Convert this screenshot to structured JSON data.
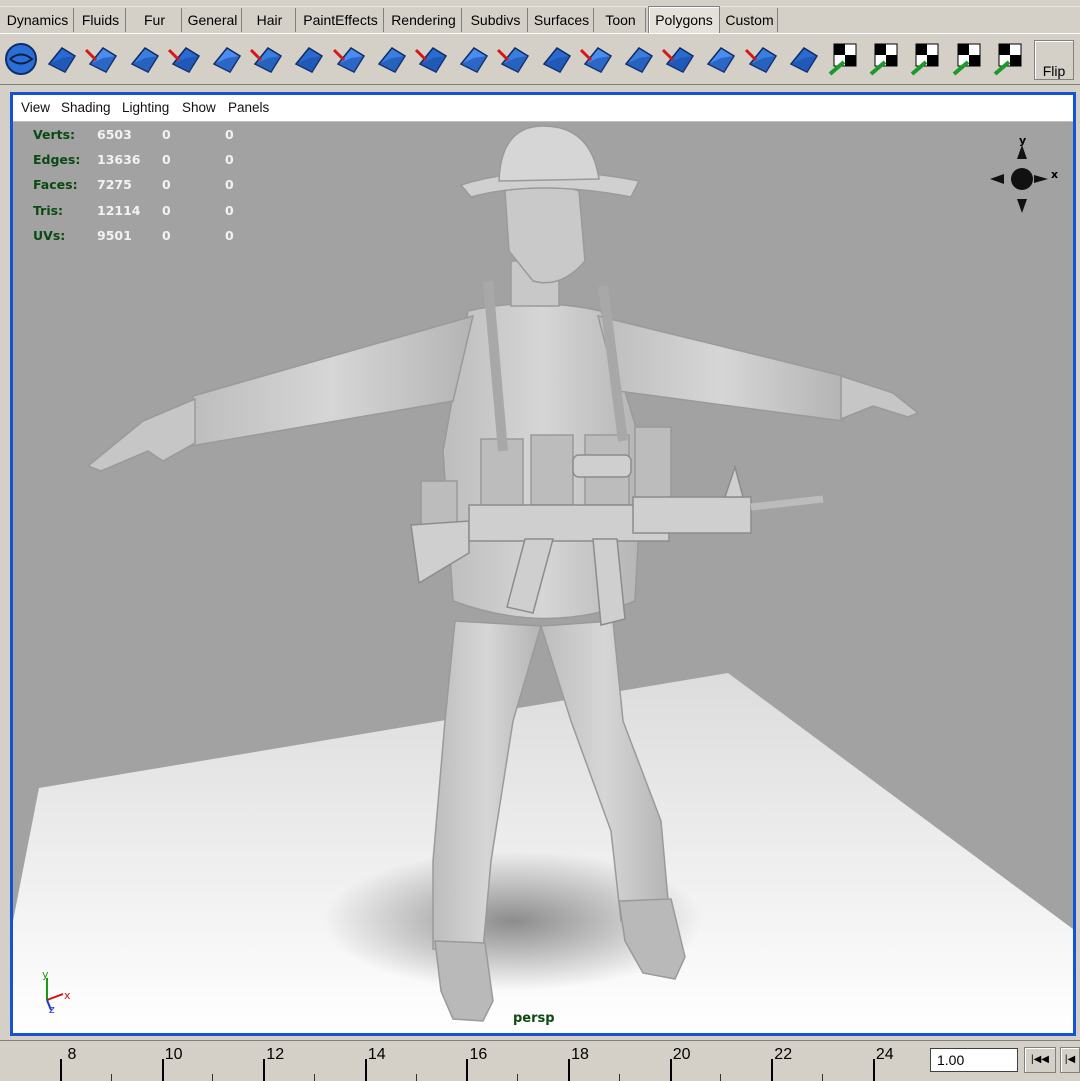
{
  "shelf": {
    "tabs": [
      {
        "label": "Dynamics"
      },
      {
        "label": "Fluids"
      },
      {
        "label": "Fur"
      },
      {
        "label": "General"
      },
      {
        "label": "Hair"
      },
      {
        "label": "PaintEffects"
      },
      {
        "label": "Rendering"
      },
      {
        "label": "Subdivs"
      },
      {
        "label": "Surfaces"
      },
      {
        "label": "Toon"
      },
      {
        "label": "Polygons"
      },
      {
        "label": "Custom"
      }
    ],
    "active_tab": "Polygons",
    "icons": [
      "sphere-icon",
      "shell-icon",
      "combine-icon",
      "separate-icon",
      "extract-icon",
      "smooth-proxy-icon",
      "cut-faces-icon",
      "split-polygon-icon",
      "extrude-face-icon",
      "extrude-edge-icon",
      "bevel-icon",
      "bridge-icon",
      "duplicate-face-icon",
      "split-edge-icon",
      "poke-face-icon",
      "wedge-face-icon",
      "merge-faces-icon",
      "mirror-icon",
      "transform-component-icon",
      "planar-map-icon",
      "cylindrical-map-icon",
      "spherical-map-icon",
      "automatic-map-icon",
      "texture-editor-icon",
      "uv-editor-icon"
    ],
    "flip_label": "Flip"
  },
  "panel": {
    "menus": [
      "View",
      "Shading",
      "Lighting",
      "Show",
      "Panels"
    ]
  },
  "hud": {
    "rows": [
      {
        "label": "Verts:",
        "v1": "6503",
        "v2": "0",
        "v3": "0"
      },
      {
        "label": "Edges:",
        "v1": "13636",
        "v2": "0",
        "v3": "0"
      },
      {
        "label": "Faces:",
        "v1": "7275",
        "v2": "0",
        "v3": "0"
      },
      {
        "label": "Tris:",
        "v1": "12114",
        "v2": "0",
        "v3": "0"
      },
      {
        "label": "UVs:",
        "v1": "9501",
        "v2": "0",
        "v3": "0"
      }
    ]
  },
  "viewport": {
    "camera": "persp",
    "viewcube_y": "y",
    "viewcube_x": "x",
    "axis_y": "y",
    "axis_z": "z",
    "axis_x": "x"
  },
  "timeline": {
    "labels": [
      "8",
      "10",
      "12",
      "14",
      "16",
      "18",
      "20",
      "22",
      "24"
    ],
    "current_frame": "1.00"
  },
  "colors": {
    "panel_border": "#1453d1",
    "viewport_bg": "#a2a2a2",
    "hud_label": "#0a4a12",
    "shelf_bg": "#d4d0c8"
  }
}
